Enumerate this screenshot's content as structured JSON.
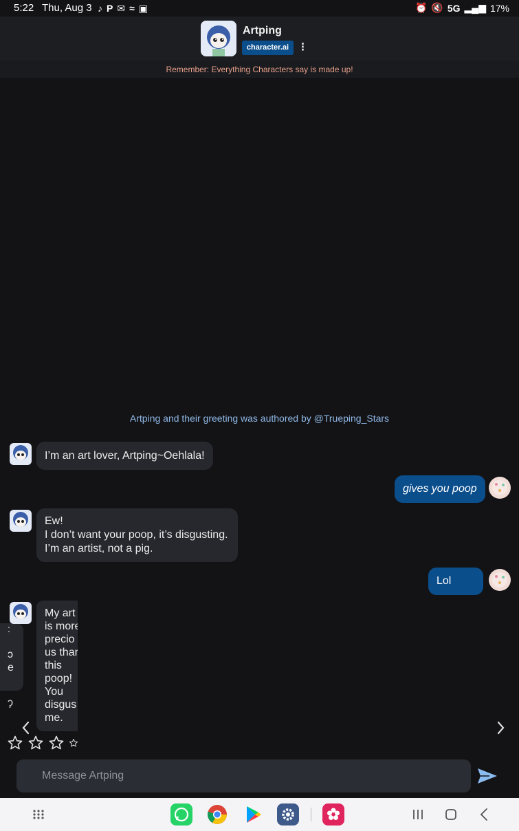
{
  "status_bar": {
    "time": "5:22",
    "date": "Thu, Aug 3",
    "network": "5G",
    "battery": "17%"
  },
  "header": {
    "character_name": "Artping",
    "brand": "character.ai",
    "menu_glyph": "⋮"
  },
  "disclaimer": "Remember: Everything Characters say is made up!",
  "authored_by": "Artping and their greeting was authored by @Trueping_Stars",
  "messages": [
    {
      "sender": "bot",
      "lines": [
        "I’m an art lover, Artping~Oehlala!"
      ]
    },
    {
      "sender": "user",
      "lines": [
        "gives you poop"
      ],
      "italic": true
    },
    {
      "sender": "bot",
      "lines": [
        "Ew!",
        "I don’t want your poop, it’s disgusting.",
        "I’m an artist, not a pig."
      ]
    },
    {
      "sender": "user",
      "lines": [
        "Lol"
      ]
    },
    {
      "sender": "bot",
      "lines": [
        "My art",
        "is more",
        "precio",
        "us thar",
        "this",
        "poop!",
        "You",
        "disgus",
        "me."
      ]
    }
  ],
  "peek_card": {
    "lines": [
      ":",
      "ɔ",
      "e",
      "ʔ"
    ]
  },
  "rating": {
    "stars_visible": 4,
    "filled": 0
  },
  "composer": {
    "placeholder": "Message Artping"
  },
  "colors": {
    "accent": "#0b4e8c",
    "background": "#131316",
    "bubble_bot": "#26282d",
    "disclaimer": "#e7a08a",
    "link": "#8fb8e6"
  },
  "icons": {
    "prev": "chevron-left-icon",
    "next": "chevron-right-icon",
    "send": "send-icon",
    "nav": [
      "app-drawer-icon",
      "whatsapp-icon",
      "chrome-icon",
      "play-store-icon",
      "settings-icon",
      "flower-app-icon",
      "recents-icon",
      "home-icon",
      "back-icon"
    ]
  }
}
